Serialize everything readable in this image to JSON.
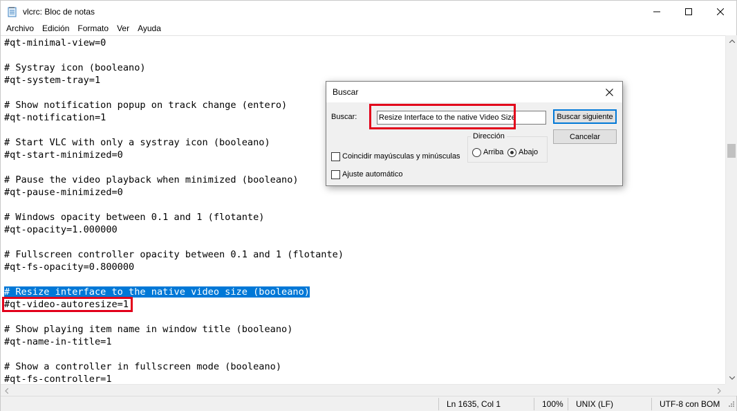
{
  "window": {
    "title": "vlcrc: Bloc de notas"
  },
  "menu": [
    "Archivo",
    "Edición",
    "Formato",
    "Ver",
    "Ayuda"
  ],
  "editor": {
    "lines": [
      "#qt-minimal-view=0",
      "",
      "# Systray icon (booleano)",
      "#qt-system-tray=1",
      "",
      "# Show notification popup on track change (entero)",
      "#qt-notification=1",
      "",
      "# Start VLC with only a systray icon (booleano)",
      "#qt-start-minimized=0",
      "",
      "# Pause the video playback when minimized (booleano)",
      "#qt-pause-minimized=0",
      "",
      "# Windows opacity between 0.1 and 1 (flotante)",
      "#qt-opacity=1.000000",
      "",
      "# Fullscreen controller opacity between 0.1 and 1 (flotante)",
      "#qt-fs-opacity=0.800000",
      "",
      "# Resize interface to the native video size (booleano)",
      "#qt-video-autoresize=1",
      "",
      "# Show playing item name in window title (booleano)",
      "#qt-name-in-title=1",
      "",
      "# Show a controller in fullscreen mode (booleano)",
      "#qt-fs-controller=1"
    ],
    "selected_line": 20
  },
  "status": {
    "position": "Ln 1635, Col 1",
    "zoom": "100%",
    "line_ending": "UNIX (LF)",
    "encoding": "UTF-8 con BOM"
  },
  "find_dialog": {
    "title": "Buscar",
    "label": "Buscar:",
    "query": "Resize Interface to the native Video Size",
    "find_next": "Buscar siguiente",
    "cancel": "Cancelar",
    "direction_label": "Dirección",
    "direction_up": "Arriba",
    "direction_down": "Abajo",
    "direction_selected": "down",
    "match_case": "Coincidir mayúsculas y minúsculas",
    "wrap": "Ajuste automático",
    "match_case_checked": false,
    "wrap_checked": false
  },
  "colors": {
    "selection": "#0078d7",
    "highlight_box": "#e2001a"
  }
}
